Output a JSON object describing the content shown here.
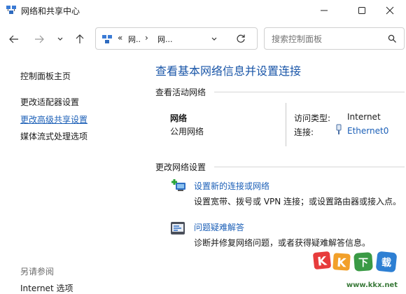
{
  "window": {
    "title": "网络和共享中心",
    "icons": {
      "app": "network-center-icon",
      "minimize": "minimize-icon",
      "maximize": "maximize-icon",
      "close": "close-icon"
    }
  },
  "nav": {
    "back_icon": "arrow-left-icon",
    "forward_icon": "arrow-right-icon",
    "history_icon": "chevron-down-icon",
    "up_icon": "arrow-up-icon"
  },
  "address": {
    "prefix": "«",
    "crumb1": "网..",
    "sep1": "›",
    "crumb2": "网...",
    "dropdown_icon": "chevron-down-icon",
    "refresh_icon": "refresh-icon"
  },
  "search": {
    "placeholder": "搜索控制面板",
    "icon": "search-icon"
  },
  "sidebar": {
    "home": "控制面板主页",
    "links": [
      "更改适配器设置",
      "更改高级共享设置",
      "媒体流式处理选项"
    ],
    "see_also_title": "另请参阅",
    "see_also_links": [
      "Internet 选项"
    ]
  },
  "main": {
    "title": "查看基本网络信息并设置连接",
    "active_networks_title": "查看活动网络",
    "network": {
      "name": "网络",
      "type": "公用网络",
      "access_label": "访问类型:",
      "access_value": "Internet",
      "connection_label": "连接:",
      "connection_value": "Ethernet0",
      "connection_icon": "ethernet-icon"
    },
    "change_settings_title": "更改网络设置",
    "tasks": [
      {
        "label": "设置新的连接或网络",
        "desc": "设置宽带、拨号或 VPN 连接；或设置路由器或接入点。",
        "icon": "new-connection-icon"
      },
      {
        "label": "问题疑难解答",
        "desc": "诊断并修复网络问题，或者获得疑难解答信息。",
        "icon": "troubleshoot-icon"
      }
    ]
  },
  "watermark": {
    "logo_text": "KK下载",
    "url": "www.kkx.net"
  },
  "colors": {
    "link": "#1b5fb7",
    "title": "#1a56a8",
    "watermark": "#e73c3c"
  }
}
